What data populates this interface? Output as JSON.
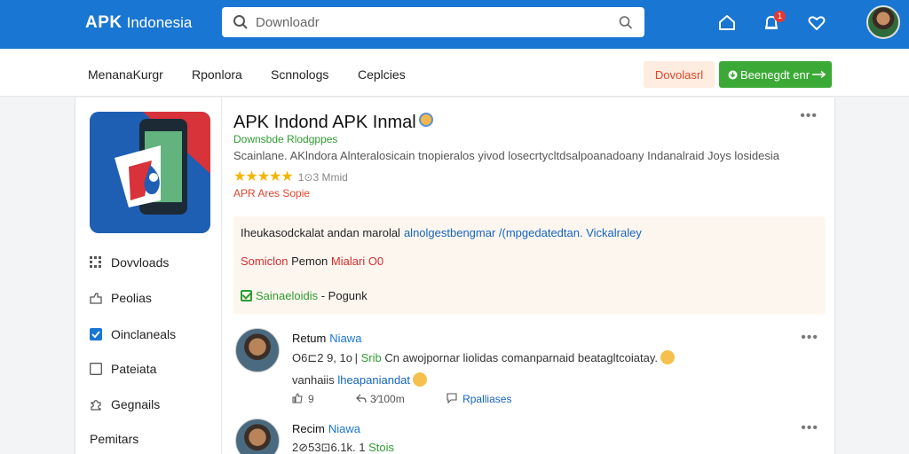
{
  "header": {
    "brand_bold": "APK",
    "brand_rest": "Indonesia",
    "search_placeholder": "Downloadr",
    "notification_count": "1"
  },
  "nav": {
    "links": [
      "MenanaKurgr",
      "Rponlora",
      "Scnnologs",
      "Ceplcies"
    ],
    "download_label": "Dovolasrl",
    "green_button_label": "Beenegdt enr"
  },
  "app": {
    "title": "APK Indond APK Inmal",
    "developer": "Downsbde Rlodgppes",
    "description": "Scainlane. AKlndora Alnteralosicain tnopieralos yivod losecrtycltdsalpoanadoany Indanalraid Joys losidesia",
    "stars": "★★★★★",
    "rating_count": "1⊙3 Mmid",
    "versions_label": "APR Ares Sopie"
  },
  "infobox": {
    "line1_dark": "Iheukasodckalat andan marolal",
    "line1_blue": "alnolgestbengmar /(mpgedatedtan. Vickalraley",
    "line2_red": "Somiclon",
    "line2_dark": "Pemon",
    "line2_red2": "Mialari O0",
    "line3_green": "Sainaeloidis",
    "line3_dark": "- Pogunk"
  },
  "sidebar": {
    "items": [
      {
        "label": "Dovvloads",
        "icon": "grid-icon"
      },
      {
        "label": "Peolias",
        "icon": "share-icon"
      },
      {
        "label": "Oinclaneals",
        "icon": "checkbox-checked-icon"
      },
      {
        "label": "Pateiata",
        "icon": "square-icon"
      },
      {
        "label": "Gegnails",
        "icon": "puzzle-icon"
      }
    ],
    "section_label": "Pemitars"
  },
  "comments": [
    {
      "name": "Retum",
      "tag": "Niawa",
      "meta_date": "O6⊏2 9, 1o |",
      "meta_green": "Srib",
      "meta_text": "Cn awojpornar liolidas comanparnaid beatagltcoiatay.",
      "line2_text": "vanhaiis",
      "line2_blue": "lheapaniandat",
      "act_like": "9",
      "act_reply": "3⁄100m",
      "act_replies": "Rpalliases"
    },
    {
      "name": "Recim",
      "tag": "Niawa",
      "meta_date": "2⊘53⊡6.1k. 1",
      "meta_green": "Stois"
    }
  ],
  "colors": {
    "header_blue": "#1976d2",
    "green": "#3aa935",
    "accent_red": "#e0452b"
  }
}
